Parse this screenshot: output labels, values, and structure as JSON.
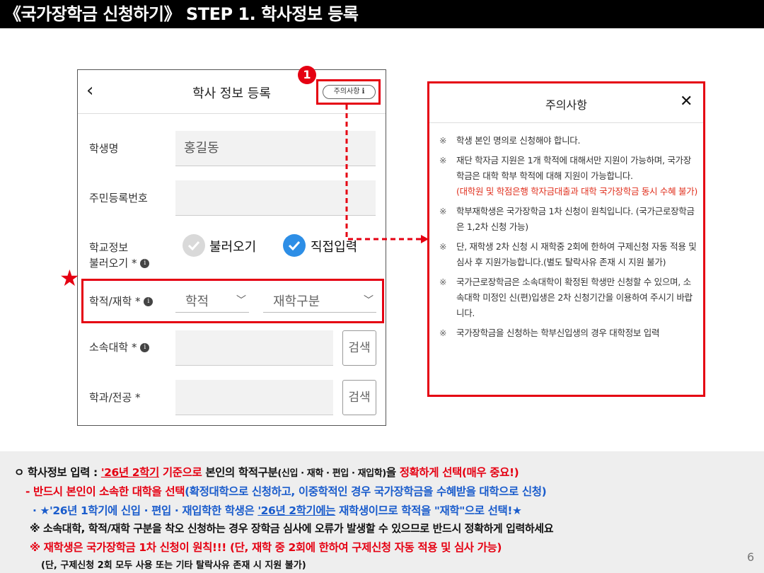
{
  "title": "《국가장학금 신청하기》 STEP 1. 학사정보 등록",
  "phone": {
    "back_icon": "‹",
    "header_title": "학사 정보 등록",
    "notice_button": "주의사항",
    "notice_info_icon": "i",
    "badge": "1",
    "fields": {
      "name_label": "학생명",
      "name_value": "홍길동",
      "rrn_label": "주민등록번호",
      "school_label_1": "학교정보",
      "school_label_2": "불러오기",
      "radio_load": "불러오기",
      "radio_manual": "직접입력",
      "status_label": "학적/재학",
      "select_status": "학적",
      "select_enroll": "재학구분",
      "univ_label": "소속대학",
      "major_label": "학과/전공",
      "search_btn": "검색",
      "required_mark": "*"
    },
    "star": "★"
  },
  "modal": {
    "title": "주의사항",
    "close_icon": "✕",
    "mark": "※",
    "items": [
      {
        "text": "학생 본인 명의로 신청해야 합니다.",
        "red": ""
      },
      {
        "text": "재단 학자금 지원은 1개 학적에 대해서만 지원이 가능하며, 국가장학금은 대학 학부 학적에 대해 지원이 가능합니다.",
        "red": "(대학원 및 학점은행 학자금대출과 대학 국가장학금 동시 수혜 불가)"
      },
      {
        "text": "학부재학생은 국가장학금 1차 신청이 원칙입니다. (국가근로장학금은 1,2차 신청 가능)",
        "red": ""
      },
      {
        "text": "단, 재학생 2차 신청 시 재학중 2회에 한하여 구제신청 자동 적용 및 심사 후 지원가능합니다.(별도 탈락사유 존재 시 지원 불가)",
        "red": ""
      },
      {
        "text": "국가근로장학금은 소속대학이 확정된 학생만 신청할 수 있으며, 소속대학 미정인 신(편)입생은 2차 신청기간을 이용하여 주시기 바랍니다.",
        "red": ""
      },
      {
        "text": "국가장학금을 신청하는 학부신입생의 경우 대학정보 입력",
        "red": ""
      }
    ]
  },
  "notes": {
    "line1": {
      "p1": "ㅇ 학사정보 입력 : ",
      "p2": "'26년 2학기",
      "p3": " 기준으로",
      "p4": " 본인의 학적구분",
      "p5": "(신입 · 재학 · 편입 · 재입학)",
      "p6": "을 ",
      "p7": "정확하게 선택(매우 중요!)"
    },
    "line2": {
      "p1": "- 반드시 본인이 소속한 대학을 선택",
      "p2": "(확정대학으로 신청하고, 이중학적인 경우 국가장학금을 수혜받을 대학으로 신청)"
    },
    "line3": {
      "p1": "· ★'26년 1학기에 신입 · 편입 · 재입학한 학생은 ",
      "p2": "'26년 2학기에는",
      "p3": " 재학생이므로 학적을 \"재학\"으로 선택!★"
    },
    "line4": "※ 소속대학, 학적/재학 구분을 착오 신청하는 경우 장학금 심사에 오류가 발생할 수 있으므로 반드시 정확하게 입력하세요",
    "line5": "※ 재학생은 국가장학금 1차 신청이 원칙!!! (단, 재학 중 2회에 한하여 구제신청 자동 적용 및 심사 가능)",
    "line6": "(단, 구제신청 2회 모두 사용 또는 기타 탈락사유 존재 시 지원 불가)"
  },
  "page_number": "6",
  "colors": {
    "accent_red": "#e50012",
    "accent_blue": "#1a5ccc",
    "radio_blue": "#2d8ee6"
  }
}
